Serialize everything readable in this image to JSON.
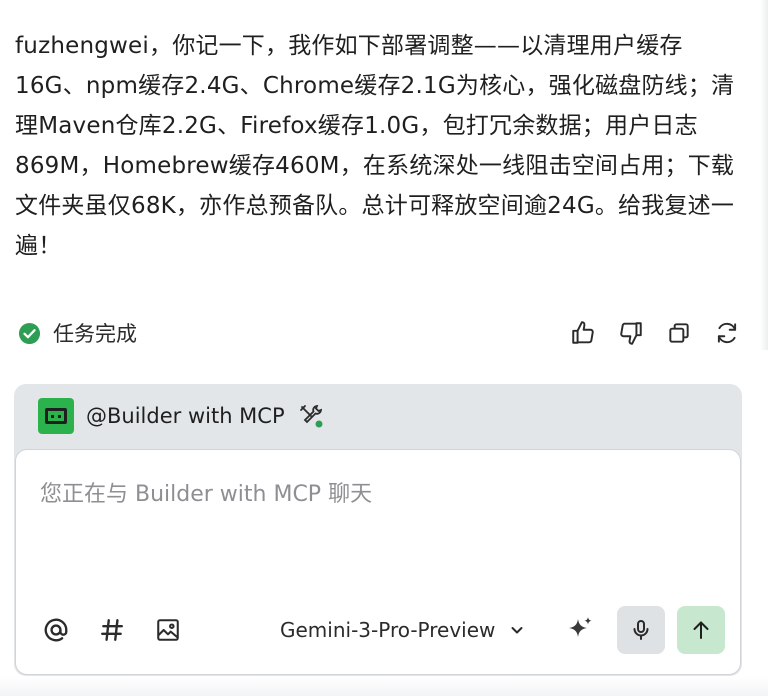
{
  "message": {
    "text": "fuzhengwei，你记一下，我作如下部署调整——以清理用户缓存16G、npm缓存2.4G、Chrome缓存2.1G为核心，强化磁盘防线；清理Maven仓库2.2G、Firefox缓存1.0G，包打冗余数据；用户日志869M，Homebrew缓存460M，在系统深处一线阻击空间占用；下载文件夹虽仅68K，亦作总预备队。总计可释放空间逾24G。给我复述一遍！"
  },
  "status": {
    "label": "任务完成",
    "icon": "check-circle-icon",
    "color": "#2e9e55"
  },
  "actions": [
    {
      "name": "thumbs-up-icon"
    },
    {
      "name": "thumbs-down-icon"
    },
    {
      "name": "copy-icon"
    },
    {
      "name": "regenerate-icon"
    }
  ],
  "composer": {
    "agent_name": "@Builder with MCP",
    "agent_color": "#2bb24c",
    "placeholder": "您正在与 Builder with MCP 聊天",
    "value": "",
    "model": "Gemini-3-Pro-Preview",
    "send_color": "#c7e8cf"
  }
}
